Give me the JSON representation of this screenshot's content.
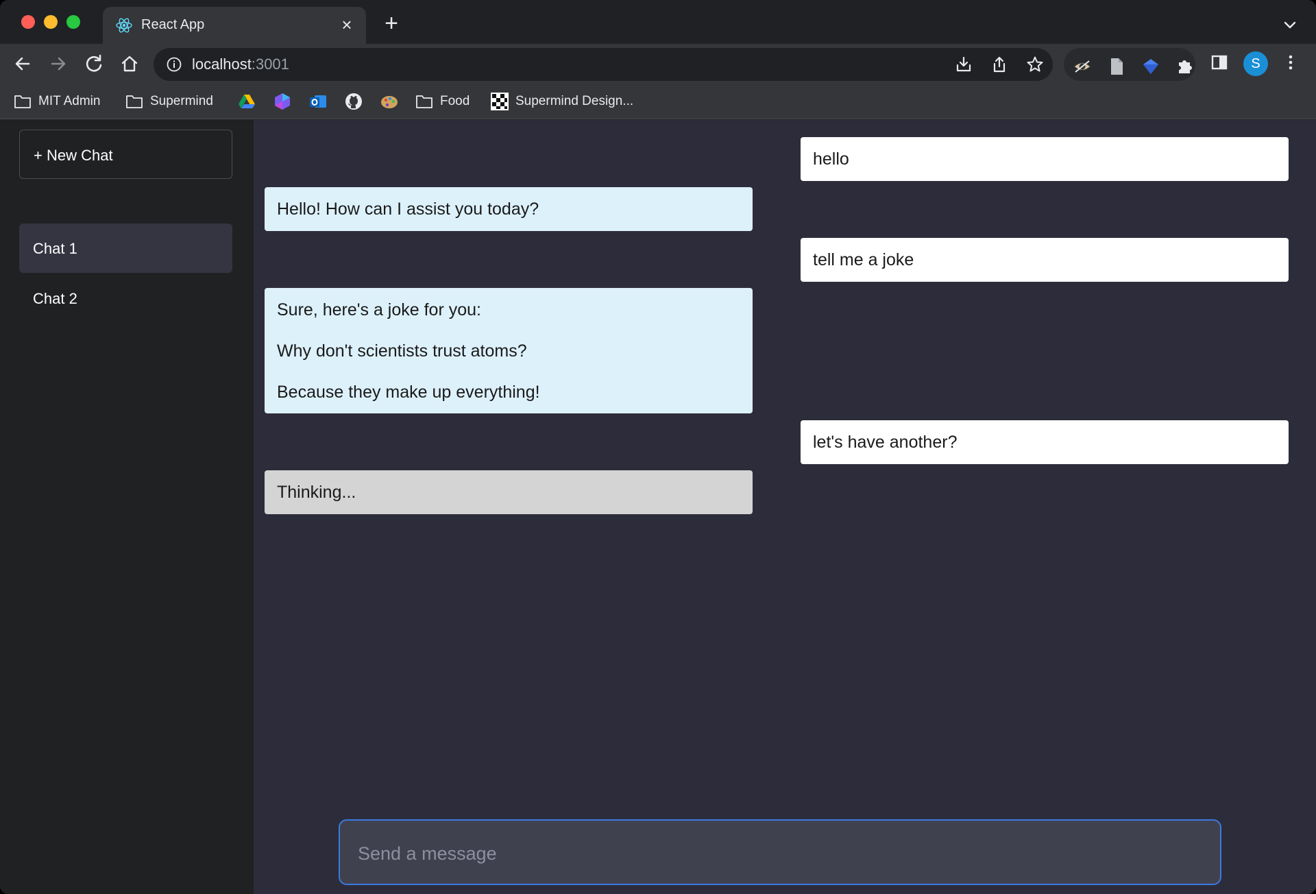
{
  "browser": {
    "tab_title": "React App",
    "url_host": "localhost",
    "url_port": ":3001",
    "avatar_letter": "S"
  },
  "bookmarks": [
    {
      "label": "MIT Admin",
      "icon": "folder-icon"
    },
    {
      "label": "Supermind",
      "icon": "folder-icon"
    },
    {
      "label": "",
      "icon": "google-drive-icon"
    },
    {
      "label": "",
      "icon": "hexagon-app-icon"
    },
    {
      "label": "",
      "icon": "outlook-icon"
    },
    {
      "label": "",
      "icon": "github-icon"
    },
    {
      "label": "",
      "icon": "palette-icon"
    },
    {
      "label": "Food",
      "icon": "folder-icon"
    },
    {
      "label": "Supermind Design...",
      "icon": "grid-logo-icon"
    }
  ],
  "sidebar": {
    "new_chat_label": "+ New Chat",
    "chats": [
      {
        "label": "Chat 1",
        "active": true
      },
      {
        "label": "Chat 2",
        "active": false
      }
    ]
  },
  "messages": [
    {
      "role": "user",
      "lines": [
        "hello"
      ]
    },
    {
      "role": "assistant",
      "lines": [
        "Hello! How can I assist you today?"
      ]
    },
    {
      "role": "user",
      "lines": [
        "tell me a joke"
      ]
    },
    {
      "role": "assistant",
      "lines": [
        "Sure, here's a joke for you:",
        "Why don't scientists trust atoms?",
        "Because they make up everything!"
      ]
    },
    {
      "role": "user",
      "lines": [
        "let's have another?"
      ]
    },
    {
      "role": "assistant",
      "lines": [
        "Thinking..."
      ],
      "status": "thinking"
    }
  ],
  "composer": {
    "placeholder": "Send a message",
    "value": ""
  },
  "colors": {
    "accent": "#3b7ae0",
    "app_background": "#2d2c3a",
    "sidebar_background": "#202123",
    "assistant_bubble": "#ddf1fb",
    "user_bubble": "#ffffff",
    "thinking_bubble": "#d4d4d4"
  }
}
